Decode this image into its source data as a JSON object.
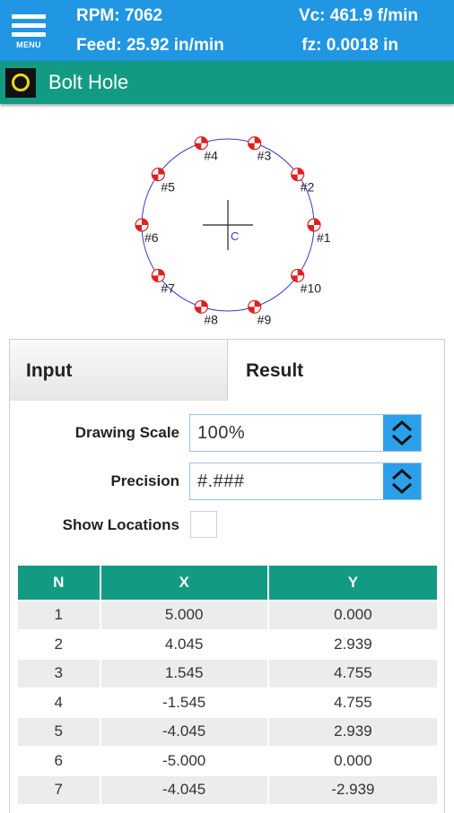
{
  "header": {
    "menu_label": "MENU",
    "rpm": "RPM: 7062",
    "feed": "Feed: 25.92 in/min",
    "vc": "Vc: 461.9 f/min",
    "fz": "fz: 0.0018 in"
  },
  "title": "Bolt Hole",
  "drawing": {
    "center_label": "C",
    "holes": [
      "#1",
      "#2",
      "#3",
      "#4",
      "#5",
      "#6",
      "#7",
      "#8",
      "#9",
      "#10"
    ],
    "colors": {
      "circle": "#3a3ad0",
      "hole_red": "#e02020",
      "label": "#222222"
    }
  },
  "tabs": {
    "input": "Input",
    "result": "Result"
  },
  "settings": {
    "drawing_scale_label": "Drawing Scale",
    "drawing_scale_value": "100%",
    "precision_label": "Precision",
    "precision_value": "#.###",
    "show_locations_label": "Show Locations"
  },
  "table": {
    "headers": [
      "N",
      "X",
      "Y"
    ],
    "rows": [
      [
        "1",
        "5.000",
        "0.000"
      ],
      [
        "2",
        "4.045",
        "2.939"
      ],
      [
        "3",
        "1.545",
        "4.755"
      ],
      [
        "4",
        "-1.545",
        "4.755"
      ],
      [
        "5",
        "-4.045",
        "2.939"
      ],
      [
        "6",
        "-5.000",
        "0.000"
      ],
      [
        "7",
        "-4.045",
        "-2.939"
      ]
    ]
  },
  "colors": {
    "header_blue": "#2196e3",
    "teal": "#129b82",
    "select_button": "#2b9fea"
  }
}
